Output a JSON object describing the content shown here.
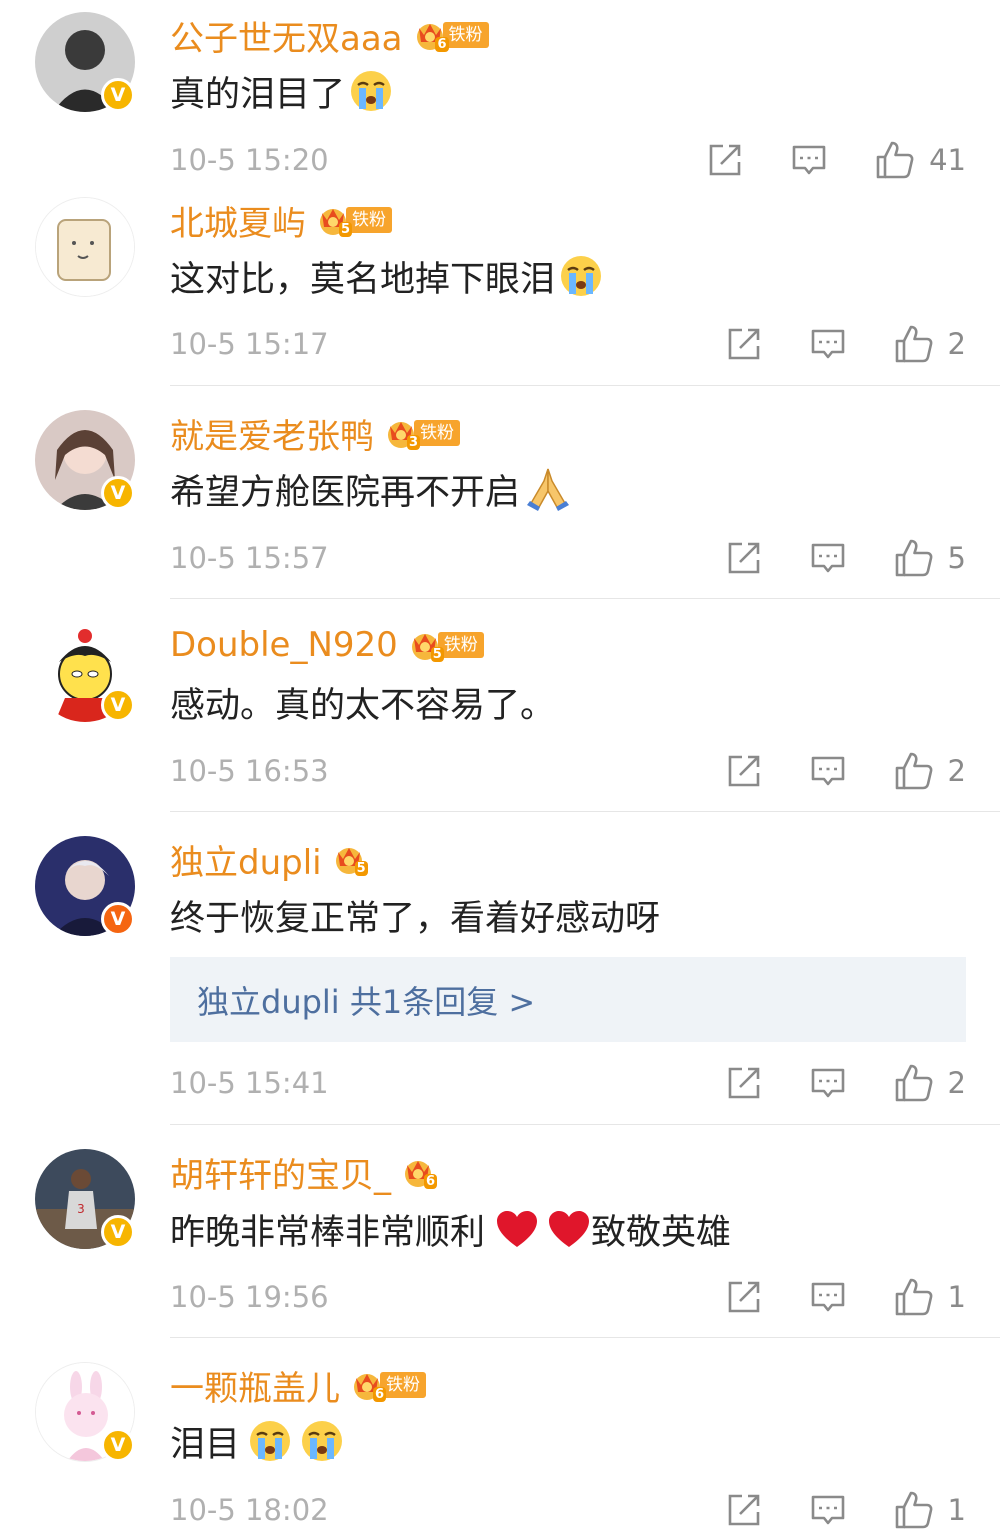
{
  "comments": [
    {
      "username": "公子世无双aaa",
      "level": "6",
      "fan_label": "铁粉",
      "badge": "V",
      "text": "真的泪目了",
      "emojis": [
        "crying-face"
      ],
      "time": "10-5 15:20",
      "likes": "41"
    },
    {
      "username": "北城夏屿",
      "level": "5",
      "fan_label": "铁粉",
      "badge": "",
      "text": "这对比，莫名地掉下眼泪",
      "emojis": [
        "crying-face"
      ],
      "time": "10-5 15:17",
      "likes": "2"
    },
    {
      "username": "就是爱老张鸭",
      "level": "3",
      "fan_label": "铁粉",
      "badge": "V",
      "text": "希望方舱医院再不开启",
      "emojis": [
        "folded-hands"
      ],
      "time": "10-5 15:57",
      "likes": "5"
    },
    {
      "username": "Double_N920",
      "level": "5",
      "fan_label": "铁粉",
      "badge": "V",
      "text": "感动。真的太不容易了。",
      "emojis": [],
      "time": "10-5 16:53",
      "likes": "2"
    },
    {
      "username": "独立dupli",
      "level": "5",
      "fan_label": "",
      "badge": "V",
      "text": "终于恢复正常了，看着好感动呀",
      "emojis": [],
      "reply": "独立dupli  共1条回复 >",
      "time": "10-5 15:41",
      "likes": "2"
    },
    {
      "username": "胡轩轩的宝贝_",
      "level": "6",
      "fan_label": "",
      "badge": "V",
      "text": "昨晚非常棒非常顺利",
      "text_after": "致敬英雄",
      "emojis": [
        "red-heart",
        "red-heart"
      ],
      "time": "10-5 19:56",
      "likes": "1"
    },
    {
      "username": "一颗瓶盖儿",
      "level": "6",
      "fan_label": "铁粉",
      "badge": "V",
      "text": "泪目",
      "emojis": [
        "crying-face",
        "crying-face"
      ],
      "time": "10-5 18:02",
      "likes": "1"
    }
  ],
  "colors": {
    "username": "#ea8c1e",
    "time": "#b0b0b0",
    "reply_link": "#4e6f9f",
    "reply_bg": "#eff3f7",
    "badge_v": "#f7b500"
  }
}
